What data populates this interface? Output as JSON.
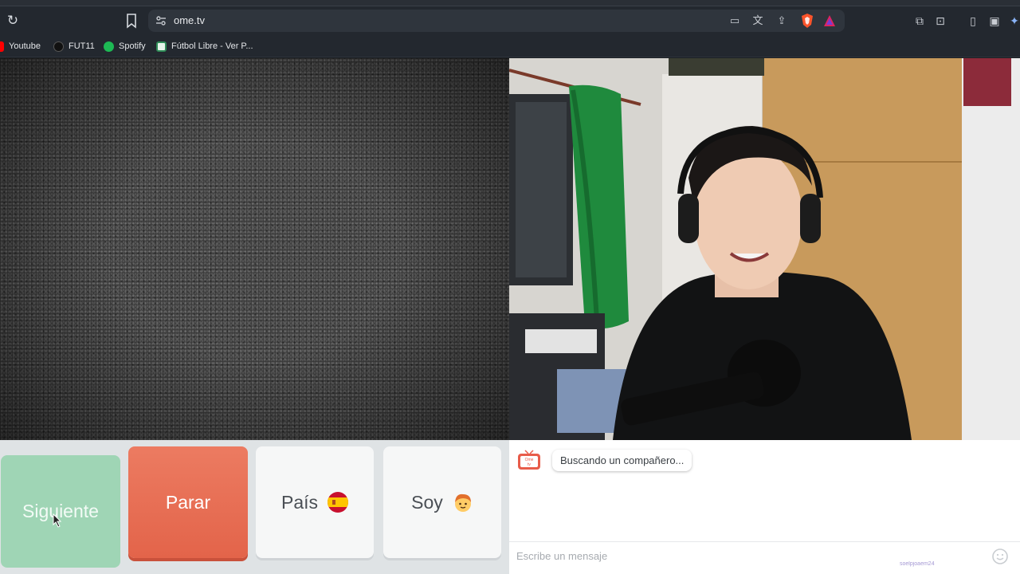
{
  "browser": {
    "url": "ome.tv",
    "bookmarks": [
      {
        "label": "Youtube",
        "icon": "youtube-icon",
        "color": "#ff0000"
      },
      {
        "label": "FUT11",
        "icon": "fut11-icon",
        "color": "#1a1a1a"
      },
      {
        "label": "Spotify",
        "icon": "spotify-icon",
        "color": "#1db954"
      },
      {
        "label": "Fútbol Libre - Ver P...",
        "icon": "futbol-libre-icon",
        "color": "#2e8b57"
      }
    ]
  },
  "controls": {
    "next_label": "Siguiente",
    "stop_label": "Parar",
    "country_label": "País",
    "country_flag": "spain-flag-icon",
    "gender_label": "Soy",
    "gender_icon": "boy-emoji-icon"
  },
  "chat": {
    "status_message": "Buscando un compañero...",
    "input_placeholder": "Escribe un mensaje",
    "watermark": "soelpjoaem24"
  },
  "colors": {
    "next": "#9fd5b5",
    "stop": "#e86b50",
    "button_neutral": "#f6f7f7"
  }
}
